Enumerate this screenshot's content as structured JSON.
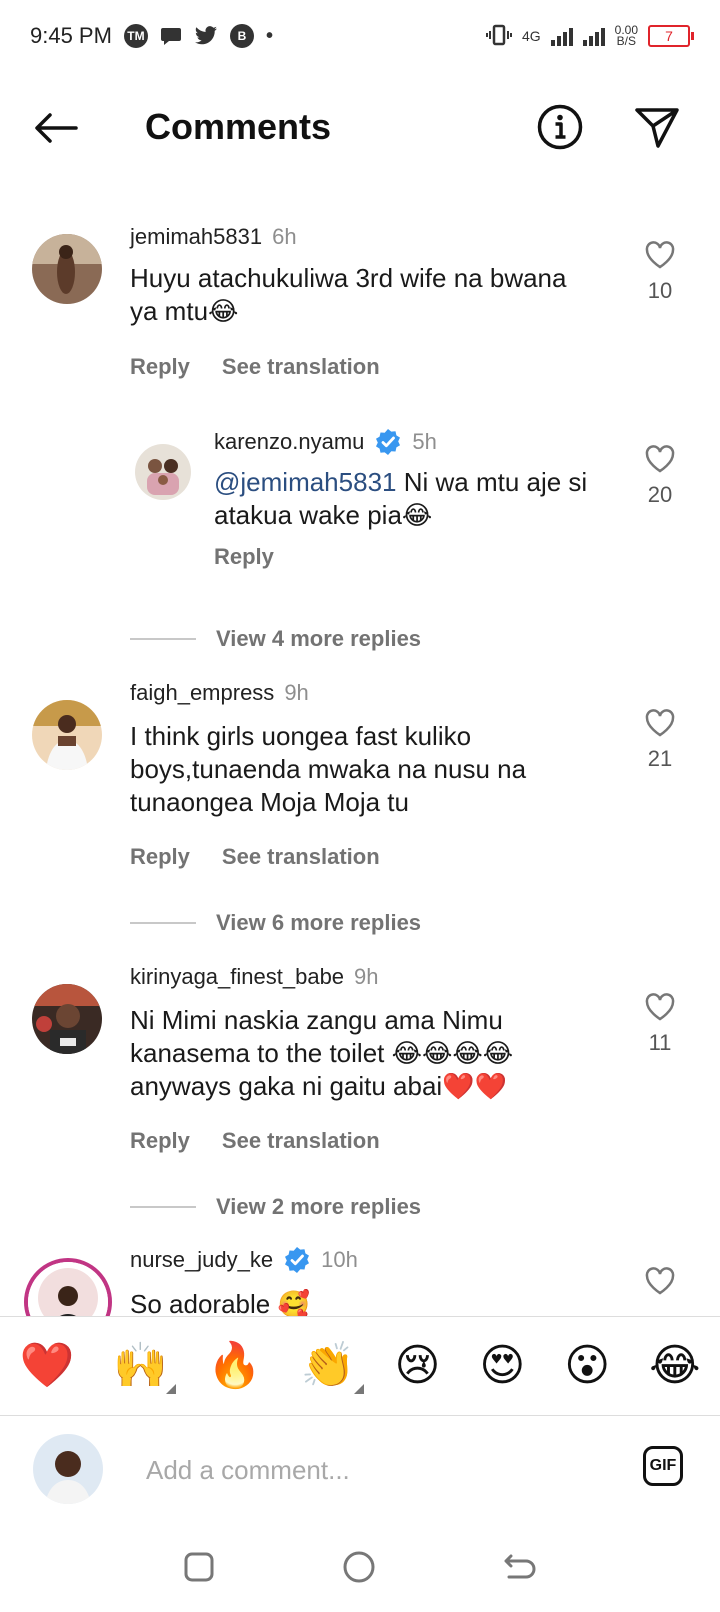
{
  "status_bar": {
    "time": "9:45 PM",
    "net_type": "4G",
    "net_speed_value": "0.00",
    "net_speed_unit": "B/S",
    "battery": "7"
  },
  "header": {
    "title": "Comments"
  },
  "comments": [
    {
      "username": "jemimah5831",
      "time": "6h",
      "text": "Huyu atachukuliwa 3rd wife na bwana ya mtu😂",
      "likes": "10",
      "reply_label": "Reply",
      "translate_label": "See translation"
    },
    {
      "username": "karenzo.nyamu",
      "time": "5h",
      "mention": "@jemimah5831",
      "text": " Ni wa mtu aje si atakua wake pia😂",
      "likes": "20",
      "reply_label": "Reply"
    },
    {
      "username": "faigh_empress",
      "time": "9h",
      "text": "I think girls uongea fast kuliko boys,tunaenda mwaka na nusu na tunaongea Moja Moja tu",
      "likes": "21",
      "reply_label": "Reply",
      "translate_label": "See translation"
    },
    {
      "username": "kirinyaga_finest_babe",
      "time": "9h",
      "text": "Ni Mimi naskia zangu ama Nimu kanasema to the toilet 😂😂😂😂 anyways gaka ni gaitu abai❤️❤️",
      "likes": "11",
      "reply_label": "Reply",
      "translate_label": "See translation"
    },
    {
      "username": "nurse_judy_ke",
      "time": "10h",
      "text": "So adorable 🥰"
    }
  ],
  "view_more": [
    "View 4 more replies",
    "View 6 more replies",
    "View 2 more replies"
  ],
  "emoji_bar": [
    "❤️",
    "🙌",
    "🔥",
    "👏",
    "😢",
    "😍",
    "😮",
    "😂"
  ],
  "input": {
    "placeholder": "Add a comment...",
    "gif_label": "GIF"
  },
  "colors": {
    "verified": "#3897f0",
    "mention": "#2b4e80",
    "story_ring": "#c13584"
  }
}
